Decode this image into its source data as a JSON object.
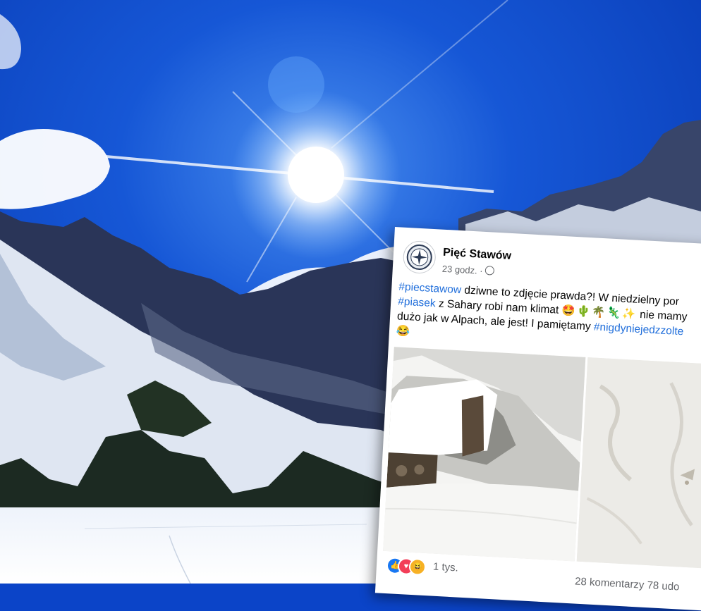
{
  "post": {
    "page_name": "Pięć Stawów",
    "time": "23 godz. ·",
    "line1": {
      "tag": "#piecstawow",
      "text": " dziwne to zdjęcie prawda?! W niedzielny por"
    },
    "line2": {
      "tag": "#piasek",
      "text": " z Sahary robi nam klimat ",
      "after": " nie mamy"
    },
    "line3": {
      "text": "dużo jak w Alpach, ale jest! I pamiętamy ",
      "tag": "#nigdyniejedzzolte"
    },
    "reaction_count": "1 tys.",
    "stats": "28 komentarzy  78 udo"
  },
  "icons": [
    "sun-icon",
    "like-reaction-icon",
    "love-reaction-icon",
    "haha-reaction-icon",
    "globe-icon"
  ],
  "colors": {
    "sky": "#0b44c8",
    "link": "#216fdb",
    "like": "#1877f2",
    "love": "#f33e58",
    "haha": "#f7b125"
  }
}
